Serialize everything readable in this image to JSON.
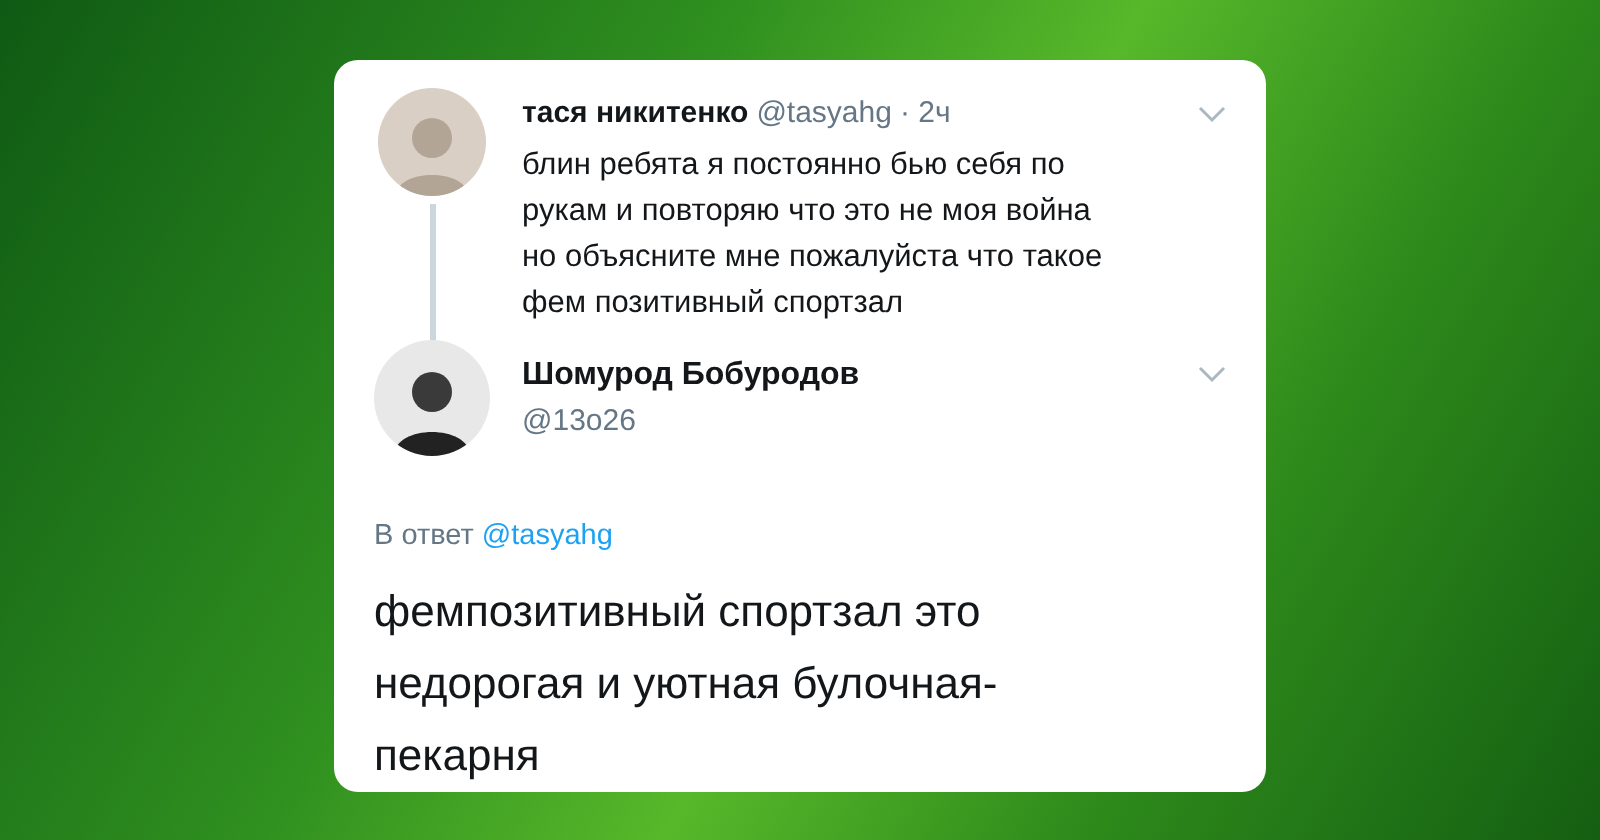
{
  "original_tweet": {
    "name": "тася никитенко",
    "handle": "@tasyahg",
    "time": "· 2ч",
    "lines": [
      "блин ребята я постоянно бью себя по",
      "рукам и повторяю что это не моя война",
      "но объясните мне пожалуйста что такое",
      "фем позитивный спортзал"
    ]
  },
  "reply_tweet": {
    "name": "Шомурод Бобуродов",
    "handle": "@13o26",
    "reply_prefix": "В ответ",
    "reply_to": "@tasyahg",
    "lines": [
      "фемпозитивный спортзал это",
      "недорогая и уютная булочная-",
      "пекарня"
    ]
  }
}
